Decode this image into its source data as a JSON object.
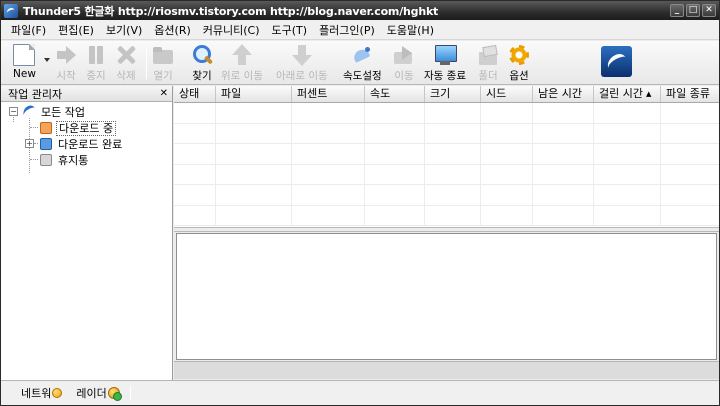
{
  "window": {
    "title": "Thunder5 한글화 http://riosmv.tistory.com  http://blog.naver.com/hghkt",
    "controls": [
      "_",
      "□",
      "✕"
    ]
  },
  "menu": [
    {
      "label": "파일(F)"
    },
    {
      "label": "편집(E)"
    },
    {
      "label": "보기(V)"
    },
    {
      "label": "옵션(R)"
    },
    {
      "label": "커뮤니티(C)"
    },
    {
      "label": "도구(T)"
    },
    {
      "label": "플러그인(P)"
    },
    {
      "label": "도움말(H)"
    }
  ],
  "toolbar": {
    "new": "New",
    "start": "시작",
    "stop": "중지",
    "delete": "삭제",
    "open": "열기",
    "find": "찾기",
    "move_up": "위로 이동",
    "move_down": "아래로 이동",
    "speed": "속도설정",
    "move": "이동",
    "auto_exit": "자동 종료",
    "folder": "폴더",
    "options": "옵션"
  },
  "left_pane": {
    "title": "작업 관리자",
    "close": "✕",
    "tree": {
      "root": "모든 작업",
      "downloading": "다운로드 중",
      "completed": "다운로드 완료",
      "trash": "휴지통"
    }
  },
  "columns": [
    "상태",
    "파일",
    "퍼센트",
    "속도",
    "크기",
    "시드",
    "남은 시간",
    "걸린 시간",
    "파일 종류"
  ],
  "sort_indicator": "▲",
  "status": {
    "network": "네트워",
    "ray": "레이더"
  },
  "colors": {
    "title_bar": "#2c2c2c",
    "downloading_icon": "#e8801c",
    "completed_icon": "#3a7fd0",
    "trash_icon": "#9a9a9a",
    "accent": "#2c6fc0"
  }
}
